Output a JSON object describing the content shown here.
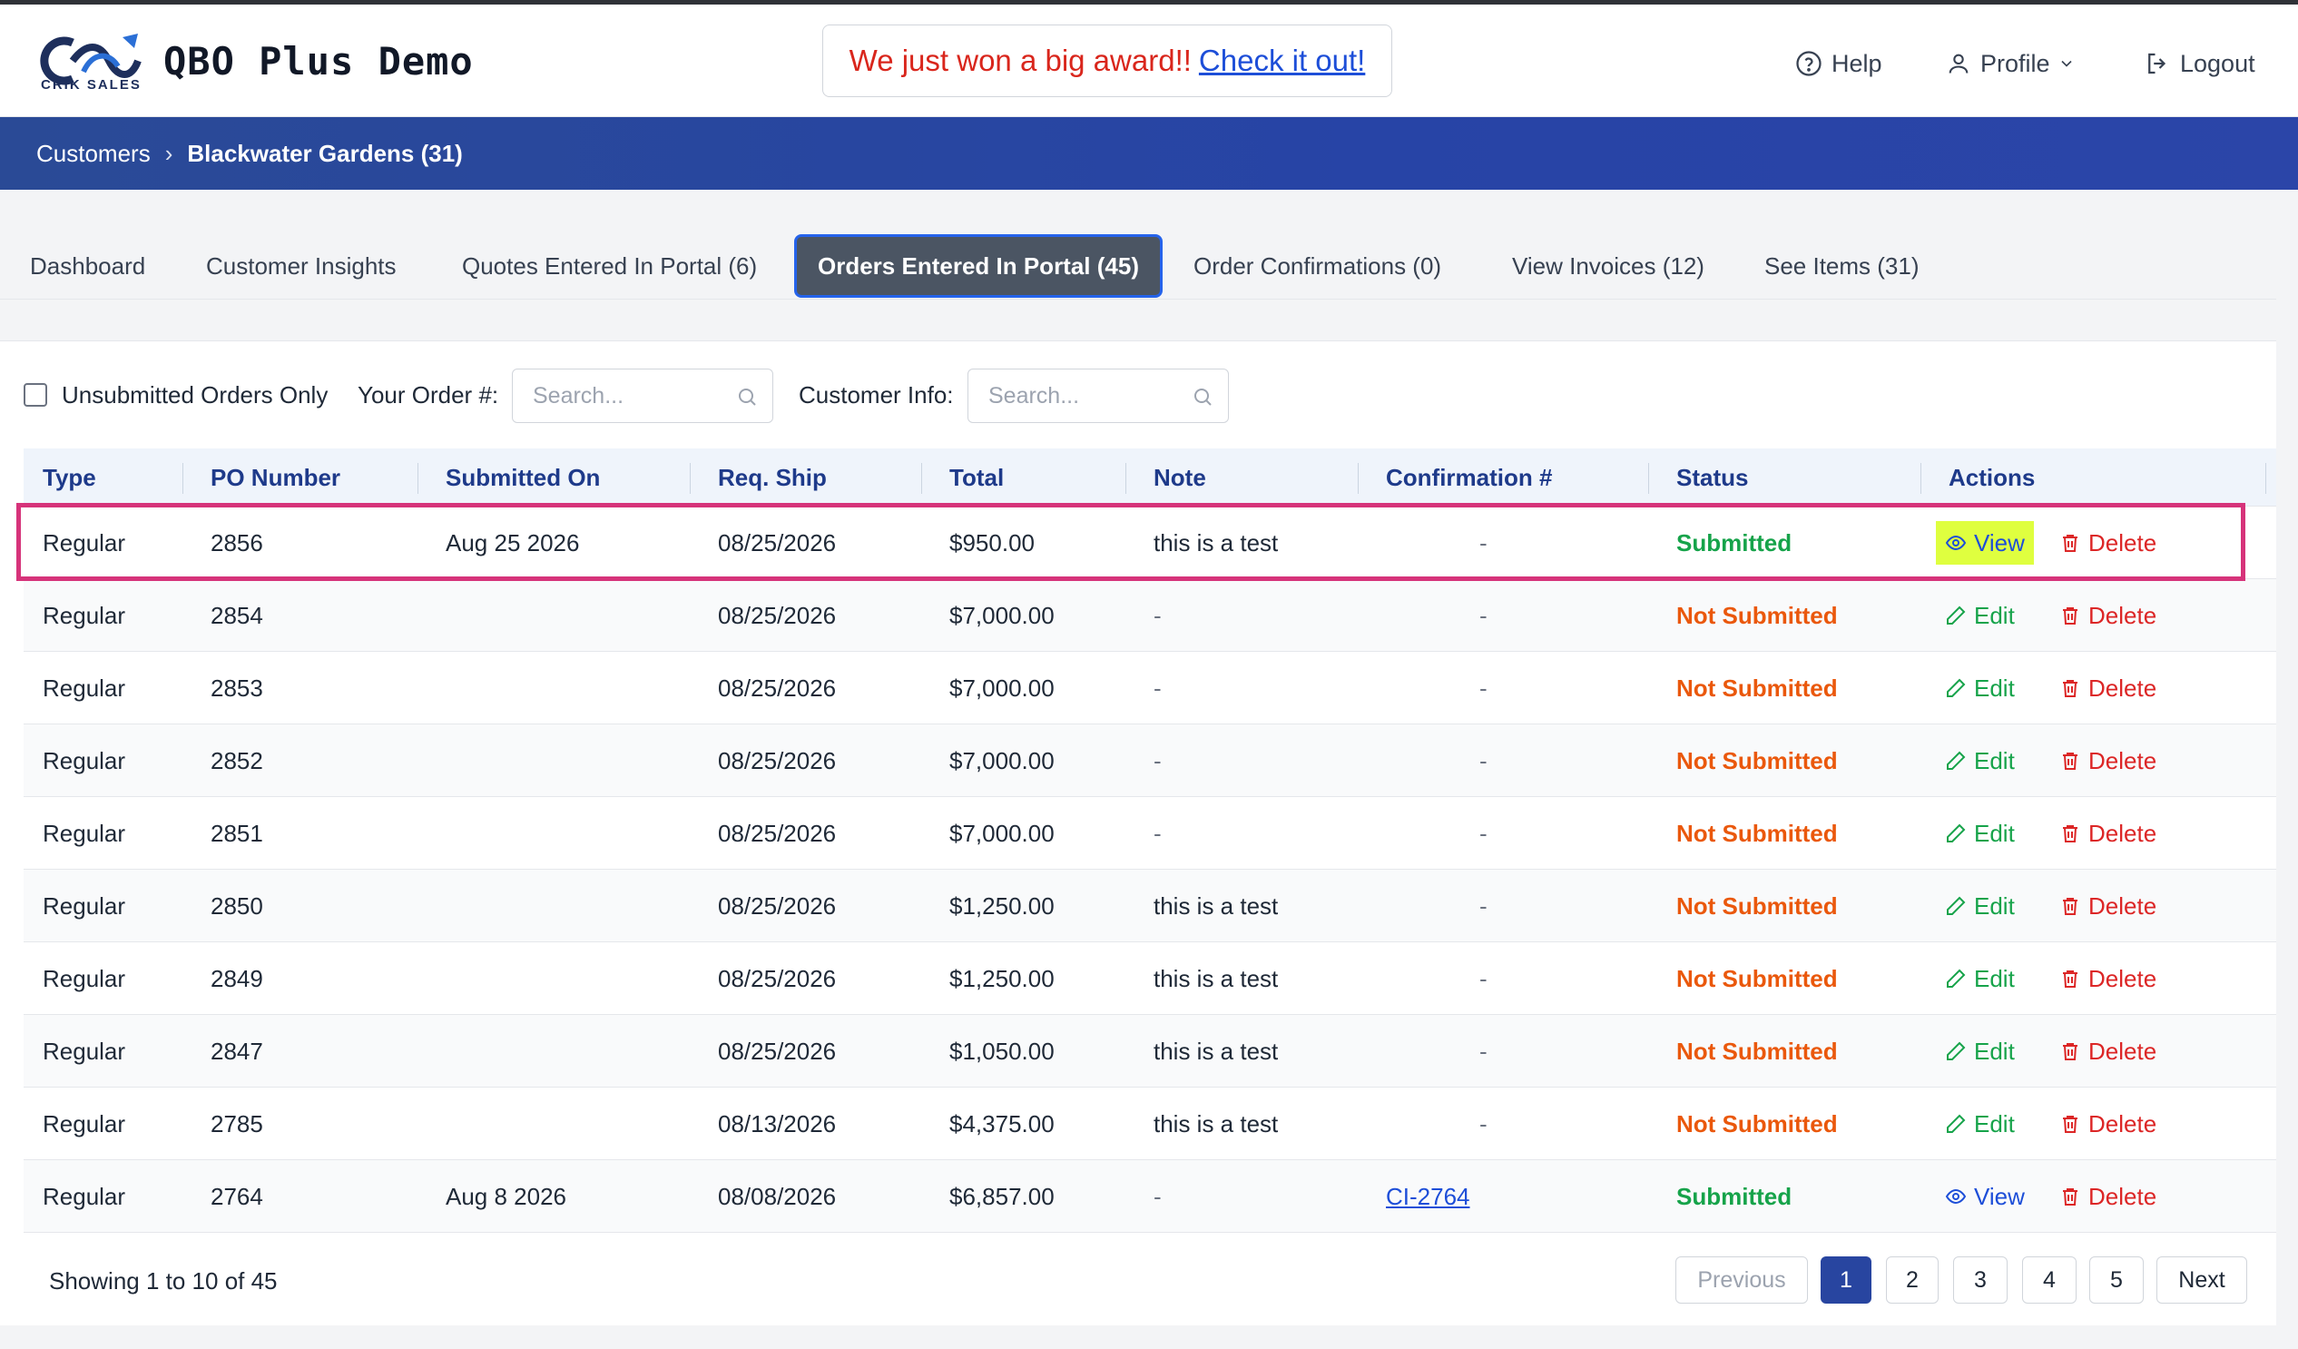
{
  "header": {
    "brand_logo_text": "CRIK SALES",
    "app_title": "QBO Plus Demo",
    "award_text": "We just won a big award!!",
    "award_link": "Check it out!",
    "help_label": "Help",
    "profile_label": "Profile",
    "logout_label": "Logout"
  },
  "breadcrumb": {
    "root": "Customers",
    "separator": "›",
    "current": "Blackwater Gardens (31)"
  },
  "tabs": [
    {
      "label": "Dashboard"
    },
    {
      "label": "Customer Insights"
    },
    {
      "label": "Quotes Entered In Portal (6)"
    },
    {
      "label": "Orders Entered In Portal (45)",
      "active": true
    },
    {
      "label": "Order Confirmations (0)"
    },
    {
      "label": "View Invoices (12)"
    },
    {
      "label": "See Items (31)"
    }
  ],
  "filters": {
    "unsubmitted_label": "Unsubmitted Orders Only",
    "unsubmitted_checked": false,
    "order_label": "Your Order #:",
    "order_placeholder": "Search...",
    "customer_label": "Customer Info:",
    "customer_placeholder": "Search..."
  },
  "table": {
    "columns": [
      "Type",
      "PO Number",
      "Submitted On",
      "Req. Ship",
      "Total",
      "Note",
      "Confirmation #",
      "Status",
      "Actions"
    ],
    "rows": [
      {
        "type": "Regular",
        "po": "2856",
        "submitted": "Aug 25 2026",
        "ship": "08/25/2026",
        "total": "$950.00",
        "note": "this is a test",
        "conf": "-",
        "status": "Submitted",
        "primary": "View",
        "secondary": "Delete"
      },
      {
        "type": "Regular",
        "po": "2854",
        "submitted": "",
        "ship": "08/25/2026",
        "total": "$7,000.00",
        "note": "-",
        "conf": "-",
        "status": "Not Submitted",
        "primary": "Edit",
        "secondary": "Delete"
      },
      {
        "type": "Regular",
        "po": "2853",
        "submitted": "",
        "ship": "08/25/2026",
        "total": "$7,000.00",
        "note": "-",
        "conf": "-",
        "status": "Not Submitted",
        "primary": "Edit",
        "secondary": "Delete"
      },
      {
        "type": "Regular",
        "po": "2852",
        "submitted": "",
        "ship": "08/25/2026",
        "total": "$7,000.00",
        "note": "-",
        "conf": "-",
        "status": "Not Submitted",
        "primary": "Edit",
        "secondary": "Delete"
      },
      {
        "type": "Regular",
        "po": "2851",
        "submitted": "",
        "ship": "08/25/2026",
        "total": "$7,000.00",
        "note": "-",
        "conf": "-",
        "status": "Not Submitted",
        "primary": "Edit",
        "secondary": "Delete"
      },
      {
        "type": "Regular",
        "po": "2850",
        "submitted": "",
        "ship": "08/25/2026",
        "total": "$1,250.00",
        "note": "this is a test",
        "conf": "-",
        "status": "Not Submitted",
        "primary": "Edit",
        "secondary": "Delete"
      },
      {
        "type": "Regular",
        "po": "2849",
        "submitted": "",
        "ship": "08/25/2026",
        "total": "$1,250.00",
        "note": "this is a test",
        "conf": "-",
        "status": "Not Submitted",
        "primary": "Edit",
        "secondary": "Delete"
      },
      {
        "type": "Regular",
        "po": "2847",
        "submitted": "",
        "ship": "08/25/2026",
        "total": "$1,050.00",
        "note": "this is a test",
        "conf": "-",
        "status": "Not Submitted",
        "primary": "Edit",
        "secondary": "Delete"
      },
      {
        "type": "Regular",
        "po": "2785",
        "submitted": "",
        "ship": "08/13/2026",
        "total": "$4,375.00",
        "note": "this is a test",
        "conf": "-",
        "status": "Not Submitted",
        "primary": "Edit",
        "secondary": "Delete"
      },
      {
        "type": "Regular",
        "po": "2764",
        "submitted": "Aug 8 2026",
        "ship": "08/08/2026",
        "total": "$6,857.00",
        "note": "-",
        "conf": "CI-2764",
        "status": "Submitted",
        "primary": "View",
        "secondary": "Delete"
      }
    ]
  },
  "pagination": {
    "showing": "Showing 1 to 10 of 45",
    "previous": "Previous",
    "pages": [
      "1",
      "2",
      "3",
      "4",
      "5"
    ],
    "current_page": "1",
    "next": "Next"
  },
  "colors": {
    "accent": "#2845a0",
    "submitted": "#16a34a",
    "not_submitted": "#ea580c",
    "delete": "#dc2626",
    "highlight": "#d6337a"
  },
  "icons": {
    "help": "help-circle-icon",
    "profile": "user-icon",
    "logout": "logout-icon",
    "search": "search-icon",
    "view": "eye-icon",
    "edit": "pencil-icon",
    "delete": "trash-icon"
  }
}
